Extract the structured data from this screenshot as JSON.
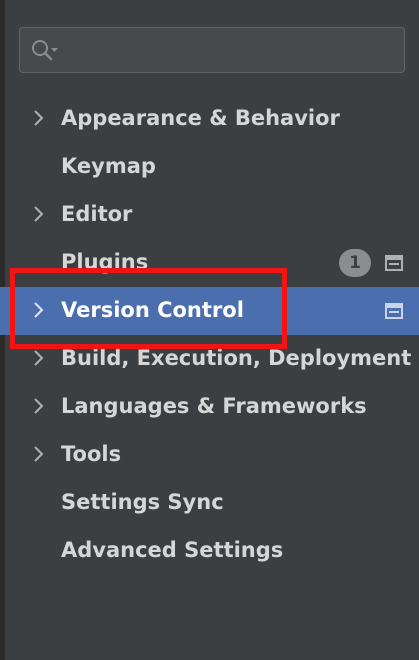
{
  "search": {
    "value": "",
    "placeholder": ""
  },
  "tree": {
    "items": [
      {
        "label": "Appearance & Behavior",
        "expandable": true
      },
      {
        "label": "Keymap",
        "expandable": false
      },
      {
        "label": "Editor",
        "expandable": true
      },
      {
        "label": "Plugins",
        "expandable": false,
        "badge": "1",
        "project_icon": true
      },
      {
        "label": "Version Control",
        "expandable": true,
        "selected": true,
        "project_icon": true,
        "highlighted": true
      },
      {
        "label": "Build, Execution, Deployment",
        "expandable": true
      },
      {
        "label": "Languages & Frameworks",
        "expandable": true
      },
      {
        "label": "Tools",
        "expandable": true
      },
      {
        "label": "Settings Sync",
        "expandable": false
      },
      {
        "label": "Advanced Settings",
        "expandable": false
      }
    ]
  },
  "colors": {
    "background": "#3c3f41",
    "selection": "#4b6eaf",
    "highlight_border": "#f11414",
    "text": "#d6d6d6"
  },
  "icons": {
    "search": "search-with-dropdown-icon",
    "expand": "chevron-right-icon",
    "project_level": "project-settings-icon"
  }
}
